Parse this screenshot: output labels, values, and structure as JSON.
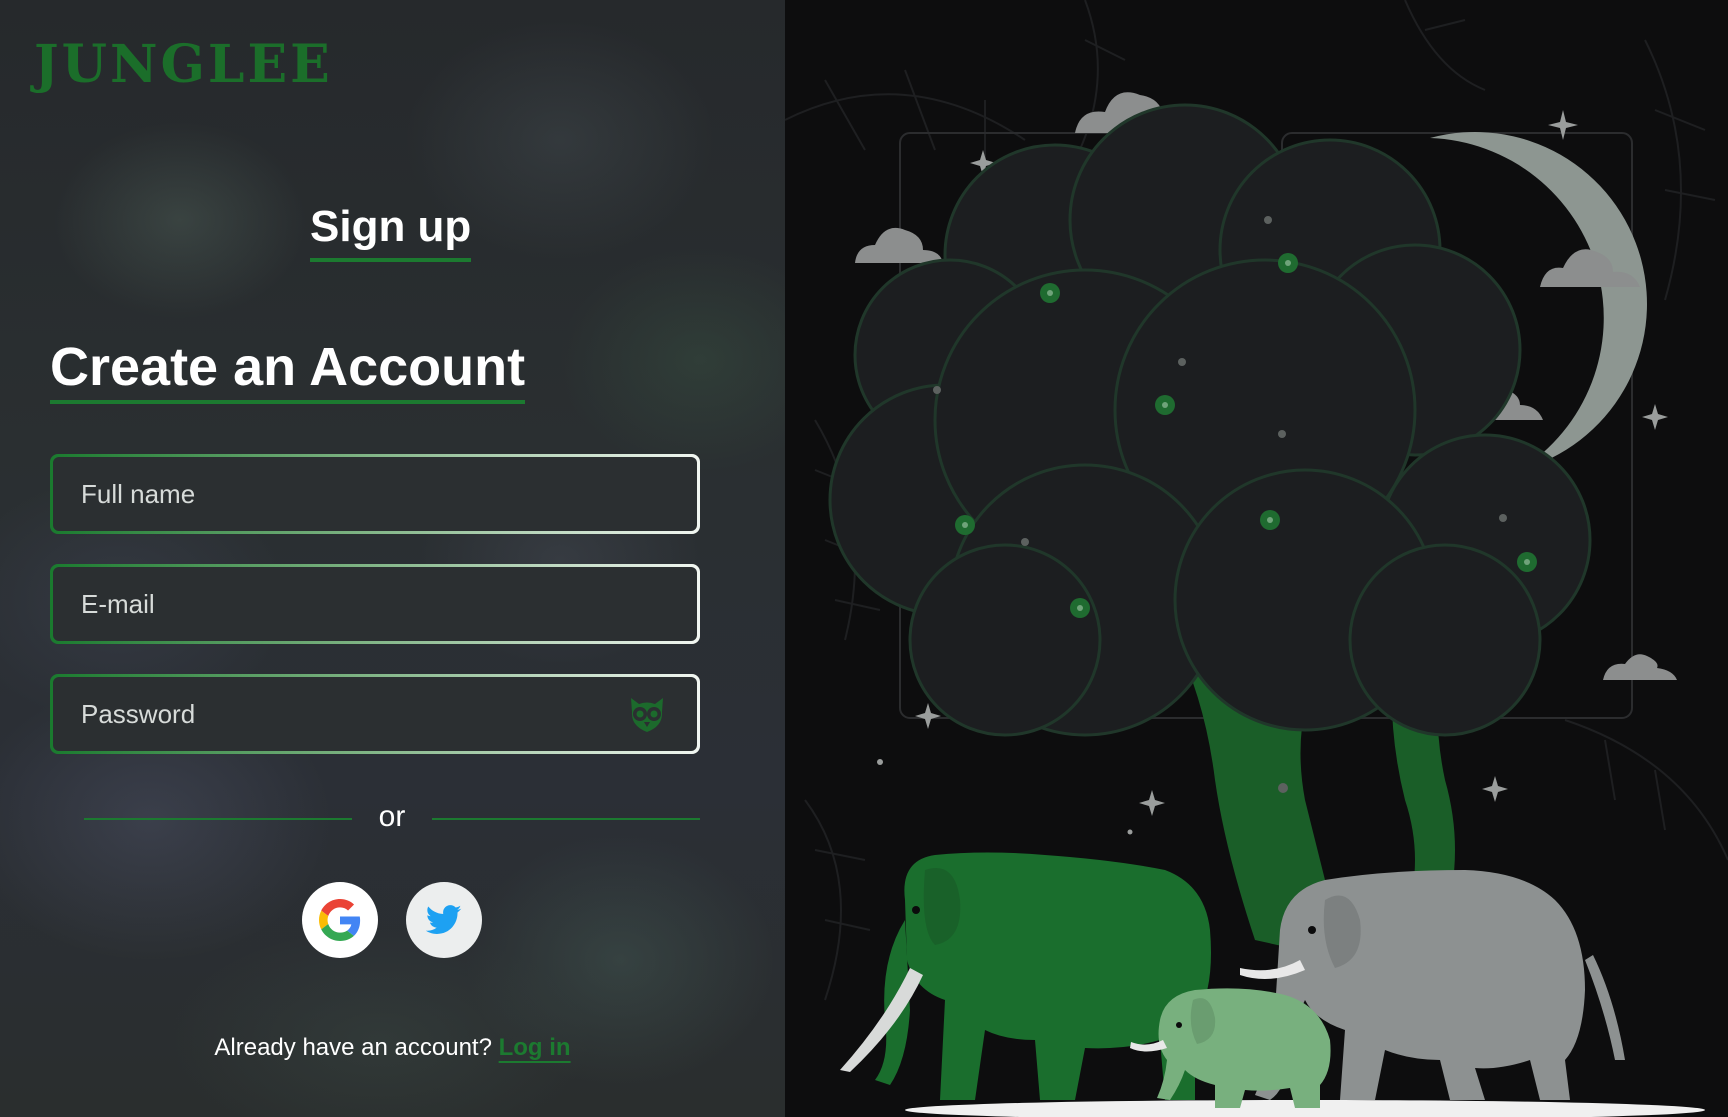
{
  "brand": {
    "logo_text": "JUNGLEE"
  },
  "tabs": {
    "signup_label": "Sign up"
  },
  "form": {
    "title": "Create an Account",
    "full_name_placeholder": "Full name",
    "email_placeholder": "E-mail",
    "password_placeholder": "Password",
    "full_name_value": "",
    "email_value": "",
    "password_value": ""
  },
  "divider": {
    "or_label": "or"
  },
  "social": [
    "google-icon",
    "twitter-icon"
  ],
  "footer": {
    "prompt": "Already have an account? ",
    "login_label": "Log in"
  },
  "colors": {
    "brand_green": "#1b6e2a",
    "accent_green": "#1c7a30",
    "panel_dark": "#2b2f31",
    "illustration_bg": "#0d0d0e",
    "elephant_green": "#1a6e2d",
    "elephant_light_green": "#78b07e",
    "elephant_grey": "#8d9191"
  }
}
